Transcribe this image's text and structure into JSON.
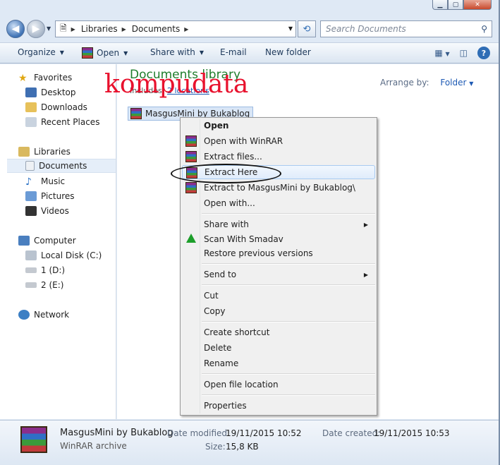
{
  "address": {
    "crumbs": [
      "Libraries",
      "Documents"
    ],
    "search_placeholder": "Search Documents"
  },
  "toolbar": {
    "organize": "Organize",
    "open": "Open",
    "share_with": "Share with",
    "email": "E-mail",
    "new_folder": "New folder"
  },
  "nav": {
    "favorites": "Favorites",
    "desktop": "Desktop",
    "downloads": "Downloads",
    "recent_places": "Recent Places",
    "libraries": "Libraries",
    "documents": "Documents",
    "music": "Music",
    "pictures": "Pictures",
    "videos": "Videos",
    "computer": "Computer",
    "local_disk": "Local Disk (C:)",
    "drive_d": "1 (D:)",
    "drive_e": "2 (E:)",
    "network": "Network"
  },
  "content": {
    "title": "Documents library",
    "includes_prefix": "Includes: ",
    "includes_link": "2 locations",
    "arrange_by": "Arrange by:",
    "arrange_value": "Folder",
    "watermark": "kompudata",
    "file_name": "MasgusMini by Bukablog"
  },
  "context_menu": {
    "open": "Open",
    "open_with_winrar": "Open with WinRAR",
    "extract_files": "Extract files...",
    "extract_here": "Extract Here",
    "extract_to": "Extract to MasgusMini by Bukablog\\",
    "open_with": "Open with...",
    "share_with": "Share with",
    "scan_smadav": "Scan With Smadav",
    "restore_versions": "Restore previous versions",
    "send_to": "Send to",
    "cut": "Cut",
    "copy": "Copy",
    "create_shortcut": "Create shortcut",
    "delete": "Delete",
    "rename": "Rename",
    "open_file_location": "Open file location",
    "properties": "Properties"
  },
  "details": {
    "name": "MasgusMini by Bukablog",
    "type": "WinRAR archive",
    "date_modified_label": "Date modified:",
    "date_modified": "19/11/2015 10:52",
    "size_label": "Size:",
    "size": "15,8 KB",
    "date_created_label": "Date created:",
    "date_created": "19/11/2015 10:53"
  },
  "colors": {
    "library_title": "#1e7d2b",
    "watermark": "#e8112d",
    "link": "#1e5ab4"
  }
}
